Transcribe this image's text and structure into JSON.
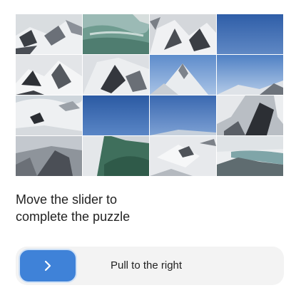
{
  "puzzle": {
    "tiles": [
      {
        "scene": "snow-rock-ridge"
      },
      {
        "scene": "aerial-green-river"
      },
      {
        "scene": "snow-slope-dark-rock"
      },
      {
        "scene": "blue-sky"
      },
      {
        "scene": "snowy-rocky-ridge"
      },
      {
        "scene": "snow-rock-face"
      },
      {
        "scene": "mountain-peak-sky"
      },
      {
        "scene": "blue-sky-horizon"
      },
      {
        "scene": "snow-cornice"
      },
      {
        "scene": "deep-blue-sky"
      },
      {
        "scene": "blue-sky-light"
      },
      {
        "scene": "dark-rock-snow"
      },
      {
        "scene": "rocky-snow-slope"
      },
      {
        "scene": "green-glacier-rock"
      },
      {
        "scene": "snow-field-rock"
      },
      {
        "scene": "glacier-lake"
      }
    ]
  },
  "instruction": "Move the slider to complete the puzzle",
  "slider": {
    "handle_icon": "chevron-right-icon",
    "label": "Pull to the right",
    "progress": 0
  },
  "colors": {
    "handle": "#3f82d8",
    "track": "#f3f3f3",
    "text": "#222222"
  }
}
